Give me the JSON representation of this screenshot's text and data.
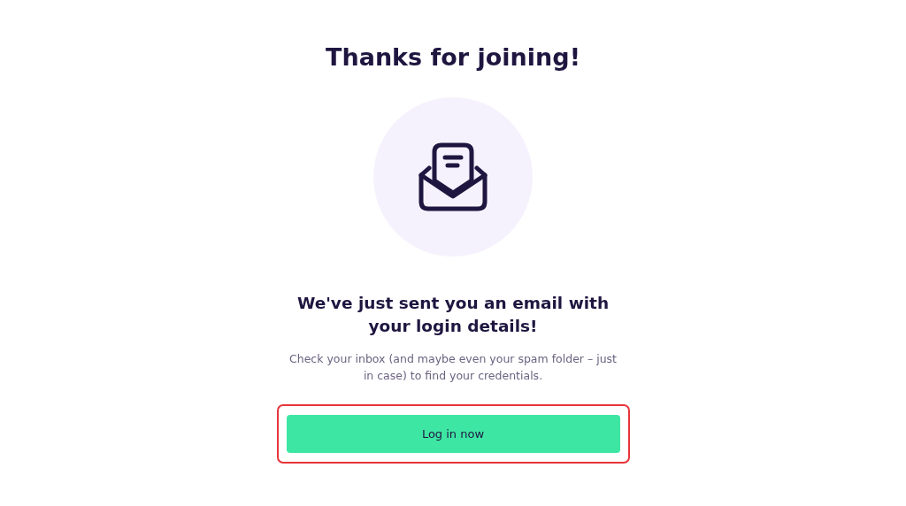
{
  "title": "Thanks for joining!",
  "message": {
    "heading": "We've just sent you an email with your login details!",
    "body": "Check your inbox (and maybe even your spam folder – just in case) to find your credentials."
  },
  "button": {
    "label": "Log in now",
    "highlighted": true
  }
}
